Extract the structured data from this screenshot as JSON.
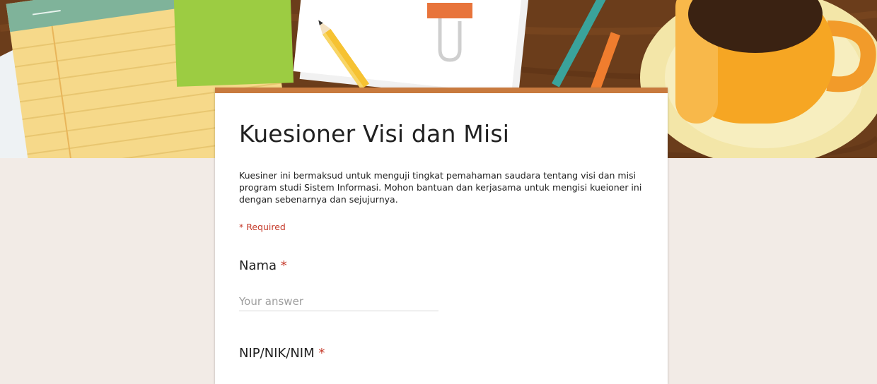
{
  "form": {
    "title": "Kuesioner Visi dan Misi",
    "description": "Kuesiner ini bermaksud untuk menguji tingkat pemahaman saudara tentang visi dan misi program studi Sistem Informasi. Mohon bantuan dan kerjasama untuk mengisi kueioner ini dengan sebenarnya dan sejujurnya.",
    "required_note": "* Required",
    "accent_color": "#c87a3e",
    "required_color": "#c53929",
    "background_color": "#f2ebe6"
  },
  "questions": [
    {
      "label": "Nama",
      "required_mark": "*",
      "placeholder": "Your answer"
    },
    {
      "label": "NIP/NIK/NIM",
      "required_mark": "*"
    }
  ],
  "header": {
    "theme_image": "desk-with-notepad-pencil-papers-coffee-cup-illustration"
  }
}
